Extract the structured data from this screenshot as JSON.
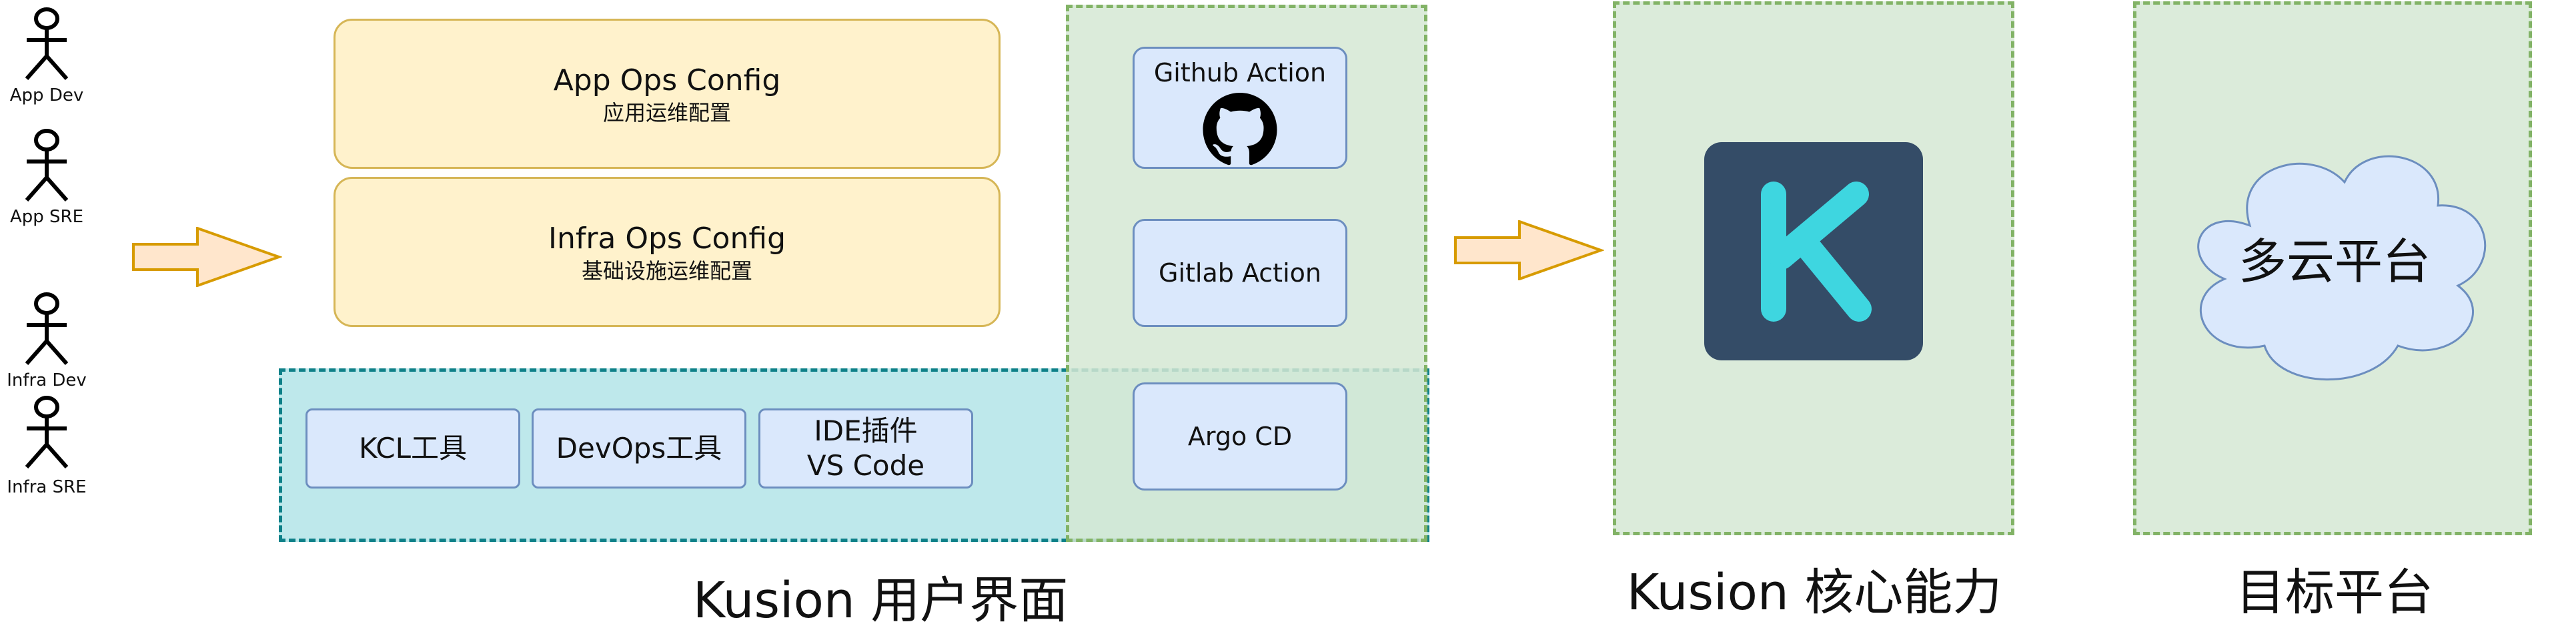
{
  "actors": [
    {
      "label": "App Dev"
    },
    {
      "label": "App SRE"
    },
    {
      "label": "Infra Dev"
    },
    {
      "label": "Infra SRE"
    }
  ],
  "configs": {
    "app": {
      "title": "App Ops Config",
      "subtitle": "应用运维配置"
    },
    "infra": {
      "title": "Infra Ops Config",
      "subtitle": "基础设施运维配置"
    }
  },
  "tools": {
    "kcl": "KCL工具",
    "devops": "DevOps工具",
    "ide_line1": "IDE插件",
    "ide_line2": "VS Code"
  },
  "ci": {
    "github": "Github Action",
    "gitlab": "Gitlab Action",
    "argo": "Argo CD"
  },
  "core": {
    "logo_letter": "K"
  },
  "target": {
    "cloud_label": "多云平台"
  },
  "captions": {
    "user_interface": "Kusion 用户界面",
    "core": "Kusion 核心能力",
    "target": "目标平台"
  },
  "colors": {
    "config_fill": "#fff2cc",
    "config_border": "#d6b656",
    "tool_fill": "#dae8fc",
    "tool_border": "#6c8ebf",
    "green_panel": "#d5e8d4",
    "green_border": "#82b366",
    "teal_panel": "#b0e3e6",
    "teal_border": "#0e8088",
    "logo_bg": "#344c67",
    "logo_fg": "#3ed6e0",
    "arrow_fill": "#ffe6cc",
    "arrow_border": "#d79b00"
  }
}
